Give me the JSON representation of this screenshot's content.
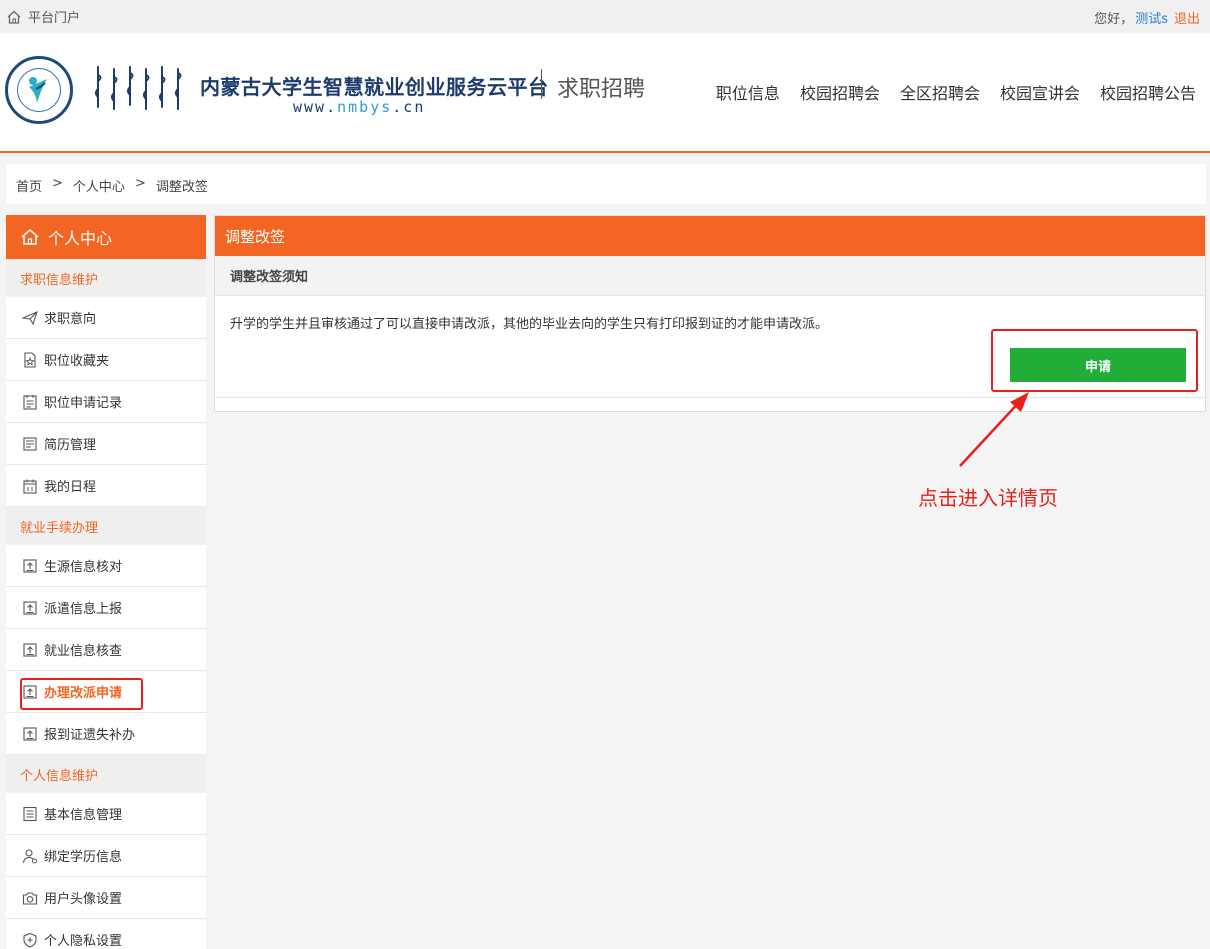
{
  "topbar": {
    "portal": "平台门户",
    "greeting": "您好，",
    "user": "测试s",
    "logout": "退出"
  },
  "header": {
    "title": "内蒙古大学生智慧就业创业服务云平台",
    "url_prefix": "www.",
    "url_highlight": "nmbys",
    "url_suffix": ".cn",
    "subsite": "求职招聘",
    "nav": [
      "职位信息",
      "校园招聘会",
      "全区招聘会",
      "校园宣讲会",
      "校园招聘公告"
    ]
  },
  "breadcrumb": [
    "首页",
    ">",
    "个人中心",
    ">",
    "调整改签"
  ],
  "sidebar": {
    "title": "个人中心",
    "groups": [
      {
        "label": "求职信息维护"
      },
      {
        "label": "就业手续办理"
      },
      {
        "label": "个人信息维护"
      }
    ],
    "items": [
      {
        "label": "求职意向"
      },
      {
        "label": "职位收藏夹"
      },
      {
        "label": "职位申请记录"
      },
      {
        "label": "简历管理"
      },
      {
        "label": "我的日程"
      },
      {
        "label": "生源信息核对"
      },
      {
        "label": "派遣信息上报"
      },
      {
        "label": "就业信息核查"
      },
      {
        "label": "办理改派申请"
      },
      {
        "label": "报到证遗失补办"
      },
      {
        "label": "基本信息管理"
      },
      {
        "label": "绑定学历信息"
      },
      {
        "label": "用户头像设置"
      },
      {
        "label": "个人隐私设置"
      }
    ]
  },
  "panel": {
    "title": "调整改签",
    "notice_title": "调整改签须知",
    "notice_text": "升学的学生并且审核通过了可以直接申请改派，其他的毕业去向的学生只有打印报到证的才能申请改派。",
    "apply_button": "申请"
  },
  "annotation": "点击进入详情页",
  "colors": {
    "accent": "#f26522",
    "apply": "#22ac38",
    "highlight": "#e8201c",
    "brand": "#1d3b6b"
  }
}
